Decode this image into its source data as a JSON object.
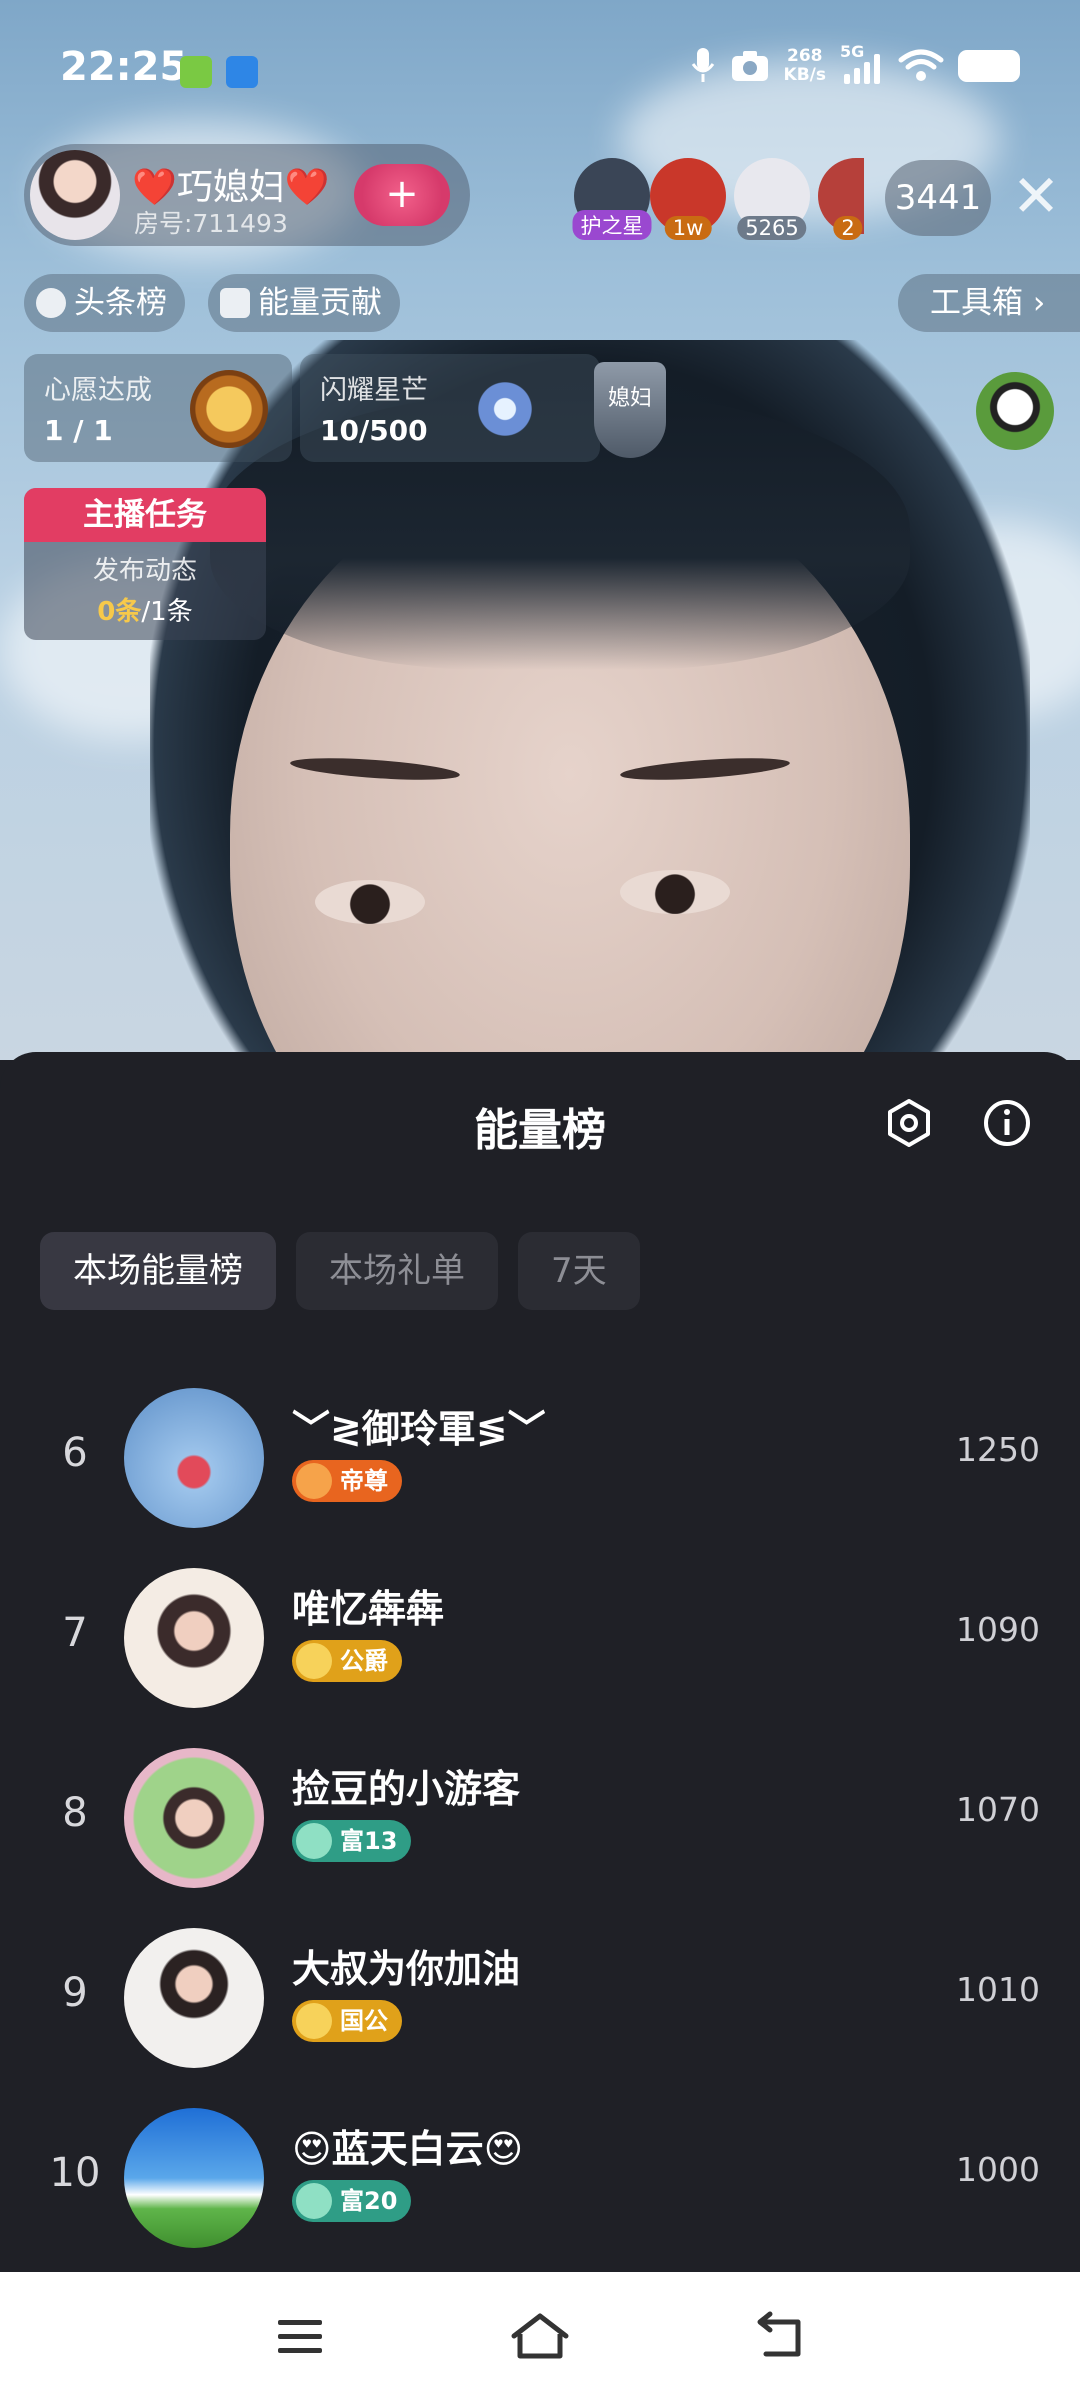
{
  "status_bar": {
    "time": "22:25",
    "net_speed_value": "268",
    "net_speed_unit": "KB/s",
    "network": "5G"
  },
  "host": {
    "name": "❤️巧媳妇❤️",
    "room": "房号:711493",
    "follow_symbol": "+"
  },
  "top_viewers": [
    {
      "tag": "护之星",
      "tag_color": "#9a48d0",
      "bg": "#3a4556"
    },
    {
      "tag": "1w",
      "tag_color": "#c96b12",
      "bg": "#c9372a"
    },
    {
      "tag": "5265",
      "tag_color": "#6d7a8a",
      "bg": "#e8e8ee"
    },
    {
      "tag": "2",
      "tag_color": "#c96b12",
      "bg": "#b6403a"
    }
  ],
  "viewer_count": "3441",
  "close_symbol": "✕",
  "ranking_pills": {
    "headline": "头条榜",
    "energy": "能量贡献",
    "toolbox": "工具箱 ›"
  },
  "wish_card": {
    "title": "心愿达成",
    "value": "1 / 1"
  },
  "star_card": {
    "title": "闪耀星芒",
    "value": "10/500",
    "badge_text": "媳妇"
  },
  "host_task": {
    "header": "主播任务",
    "title": "发布动态",
    "done": "0条",
    "total": "/1条"
  },
  "sheet": {
    "title": "能量榜",
    "tabs": [
      {
        "label": "本场能量榜",
        "active": true
      },
      {
        "label": "本场礼单",
        "active": false
      },
      {
        "label": "7天",
        "active": false
      }
    ],
    "rows": [
      {
        "rank": "6",
        "name": "﹀≷御玲軍≶﹀",
        "level": "帝尊",
        "score": "1250",
        "level_color": "#e8651f",
        "avatar_bg": "#7aa6d6"
      },
      {
        "rank": "7",
        "name": "唯忆犇犇",
        "level": "公爵",
        "score": "1090",
        "level_color": "#e0a11a",
        "avatar_bg": "#f1e4d6"
      },
      {
        "rank": "8",
        "name": "捡豆的小游客",
        "level": "富13",
        "score": "1070",
        "level_color": "#2f9d86",
        "avatar_bg": "#d7c8b5"
      },
      {
        "rank": "9",
        "name": "大叔为你加油",
        "level": "国公",
        "score": "1010",
        "level_color": "#e0a11a",
        "avatar_bg": "#e6e2df"
      },
      {
        "rank": "10",
        "name": "😍蓝天白云😍",
        "level": "富20",
        "score": "1000",
        "level_color": "#2f9d86",
        "avatar_bg": "#3d83d9"
      }
    ]
  },
  "colors": {
    "accent_red": "#e23d63",
    "sheet_bg": "#1f2026",
    "task_highlight": "#f7c94a"
  },
  "icons": {
    "settings": "hexagon-settings-icon",
    "info": "info-icon",
    "nav_menu": "menu-icon",
    "nav_home": "home-icon",
    "nav_back": "back-icon"
  }
}
